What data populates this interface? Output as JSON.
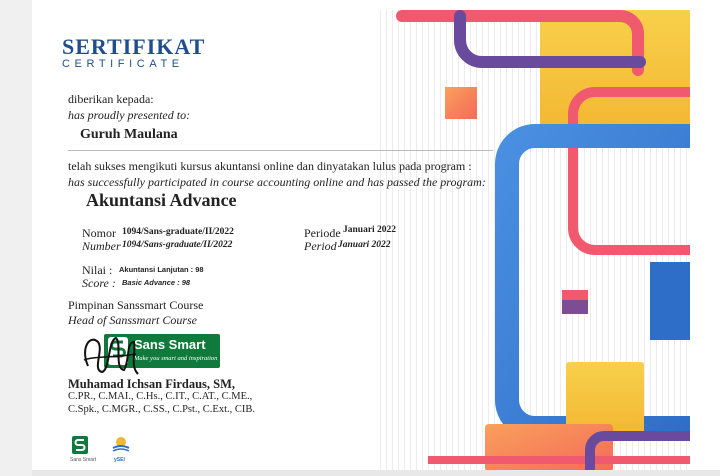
{
  "certificate": {
    "title": "SERTIFIKAT",
    "subtitle": "CERTIFICATE",
    "given_to_id": "diberikan kepada:",
    "given_to_en": "has proudly presented to:",
    "recipient": "Guruh Maulana",
    "statement_id": "telah sukses mengikuti kursus akuntansi online dan dinyatakan lulus pada program :",
    "statement_en": "has successfully participated in course accounting online and has passed the program:",
    "program": "Akuntansi Advance",
    "number_label_id": "Nomor",
    "number_label_en": "Number",
    "number_value": "1094/Sans-graduate/II/2022",
    "period_label_id": "Periode",
    "period_label_en": "Period",
    "period_value": "Januari 2022",
    "grade_label_id": "Nilai :",
    "grade_label_en": "Score :",
    "grade_value_id": "Akuntansi Lanjutan : 98",
    "grade_value_en": "Basic Advance  : 98",
    "head_label_id": "Pimpinan Sanssmart Course",
    "head_label_en": "Head of Sanssmart Course",
    "signer_name": "Muhamad Ichsan Firdaus, SM,",
    "signer_credentials_1": "C.PR., C.MAI., C.Hs., C.IT., C.AT., C.ME.,",
    "signer_credentials_2": "C.Spk., C.MGR., C.SS., C.Pst., C.Ext., CIB."
  },
  "logos": {
    "brand_name": "Sans Smart",
    "brand_tagline": "Make you smart and inspiration",
    "footer_logo_1_label": "Sans Smart",
    "footer_logo_2_label": "ySEI"
  },
  "colors": {
    "title_blue": "#1f4e89",
    "brand_green": "#0f7a3c",
    "art_yellow": "#f6c843",
    "art_blue": "#3b7fd6",
    "art_pink": "#f0596e",
    "art_purple": "#6a4a9c",
    "art_orange": "#f78a4a"
  }
}
